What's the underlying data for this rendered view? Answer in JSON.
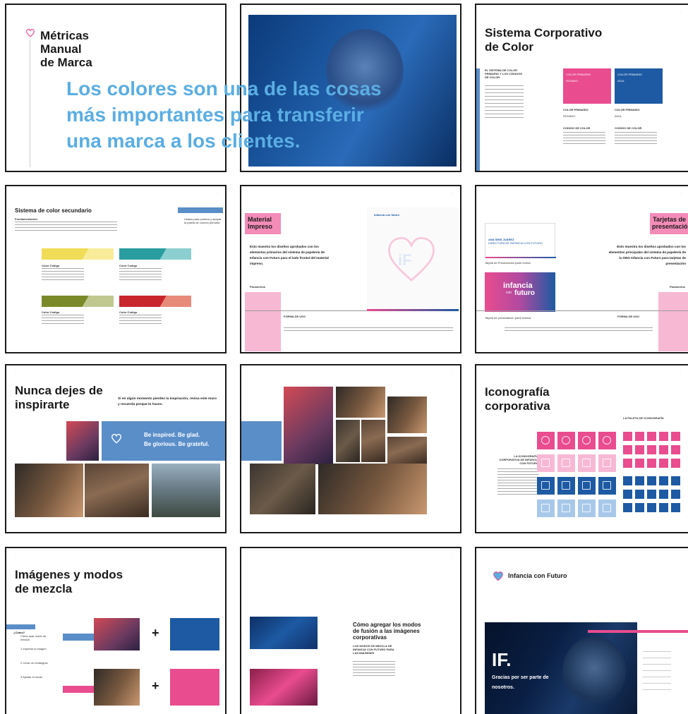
{
  "p1": {
    "title_lines": [
      "Métricas",
      "Manual",
      "de Marca"
    ],
    "quote_lines": [
      "Los colores son una de las cosas",
      "más importantes para transferir",
      "una marca a los clientes."
    ],
    "colors": {
      "quote": "#5aaee3",
      "heart": "#e94c8f"
    }
  },
  "p3": {
    "title_lines": [
      "Sistema Corporativo",
      "de Color"
    ],
    "sub_heading": "EL SISTEMA DE COLOR PRIMARIO Y LOS CÓDIGOS DE COLOR",
    "swatch_pink_label": "COLOR PRIMARIO",
    "swatch_pink_name": "ROSADO",
    "swatch_blue_label": "COLOR PRIMARIO",
    "swatch_blue_name": "AZUL",
    "pink_primary": "COLOR PRIMARIO",
    "pink_name": "ROSADO",
    "blue_primary": "COLOR PRIMARIO",
    "blue_name": "AZUL",
    "code_label_pink": "CODIGO DE COLOR",
    "code_label_blue": "CODIGO DE COLOR",
    "colors": {
      "pink": "#e94c8f",
      "blue": "#1d5aa3"
    }
  },
  "p4": {
    "title": "Sistema de color secundario",
    "tab_label": "Uso del color",
    "body_heading": "Fundamentación",
    "side_text": "Usalos para puntear y apoyar la paleta de colores primaria.",
    "swatch_labels": [
      "Color Código",
      "Color Código",
      "Color Código",
      "Color Código"
    ],
    "colors": [
      "#f1dc58",
      "#2a9da0",
      "#7a8a2a",
      "#c8262b"
    ]
  },
  "p5": {
    "title_lines": [
      "Material",
      "Impreso"
    ],
    "intro": "Esto muestra los diseños aprobados con los elementos primarios del sistema de papelería de Infancia con Futuro para el lado frontal del material impreso.",
    "params": "Parametros",
    "uso": "FORMA DE USO",
    "logo_text": "Infancia con futuro",
    "big_mark": "iF"
  },
  "p6": {
    "title_lines": [
      "Tarjetas de",
      "presentación"
    ],
    "intro": "Esto muestra los diseños aprobados con los elementos principales del sistema de papelería de la ONG Infancia con Futuro para tarjetas de presentación",
    "card_name": "ANA SIMS JUÁREZ",
    "card_role": "DIRECTORA DE INFANCIA CON FUTURO",
    "card_logo_big": "infancia",
    "card_logo_con": "con",
    "card_logo_futuro": "futuro",
    "front_caption": "Tarjeta de Presentación parte frontal",
    "back_caption": "Tarjeta de presentación parte trasera",
    "params": "Parametros",
    "uso": "FORMA DE USO"
  },
  "p7": {
    "title_lines": [
      "Nunca dejes de",
      "inspirarte"
    ],
    "side_text_lines": [
      "Si en algún momento pierdes la inspiración, revisa este muro",
      "y recuerda porque lo haces."
    ],
    "banner_lines": [
      "Be inspired. Be glad.",
      "Be glorious. Be grateful."
    ],
    "colors": {
      "banner": "#5a8ec9"
    }
  },
  "p9": {
    "title_lines": [
      "Iconografía",
      "corporativa"
    ],
    "palette_label": "LA PALETA DE ICONOGRAFÍA",
    "body_heading": "LA ICONOGRAFÍA CORPORATIVA DE INFANCIA CON FUTURO",
    "colors": {
      "pink": "#e94c8f",
      "lightpink": "#f7b8d3",
      "blue": "#1d5aa3",
      "lightblue": "#a8c8ea"
    }
  },
  "p10": {
    "title_lines": [
      "Imágenes y modos",
      "de mezcla"
    ],
    "how": "¿Cómo?",
    "how_text": "Cómo usar modo de mezcla",
    "steps": [
      "1 Importar la imagen",
      "2 Crear un rectángulo",
      "3 Ajustar el modo"
    ],
    "blue_label": "Imágenes obscuras",
    "pink_label": "Imágenes claras",
    "plus": "+"
  },
  "p11": {
    "title_lines": [
      "Cómo agregar los modos",
      "de fusión a las imágenes",
      "corporativas"
    ],
    "sub_heading": "LOS MODOS DE MEZCLA DE INFANCIA CON FUTURO PARA LAS IMÁGENES"
  },
  "p12": {
    "brand": "Infancia con Futuro",
    "big": "IF.",
    "thanks_lines": [
      "Gracias por ser parte de",
      "nosotros."
    ]
  }
}
